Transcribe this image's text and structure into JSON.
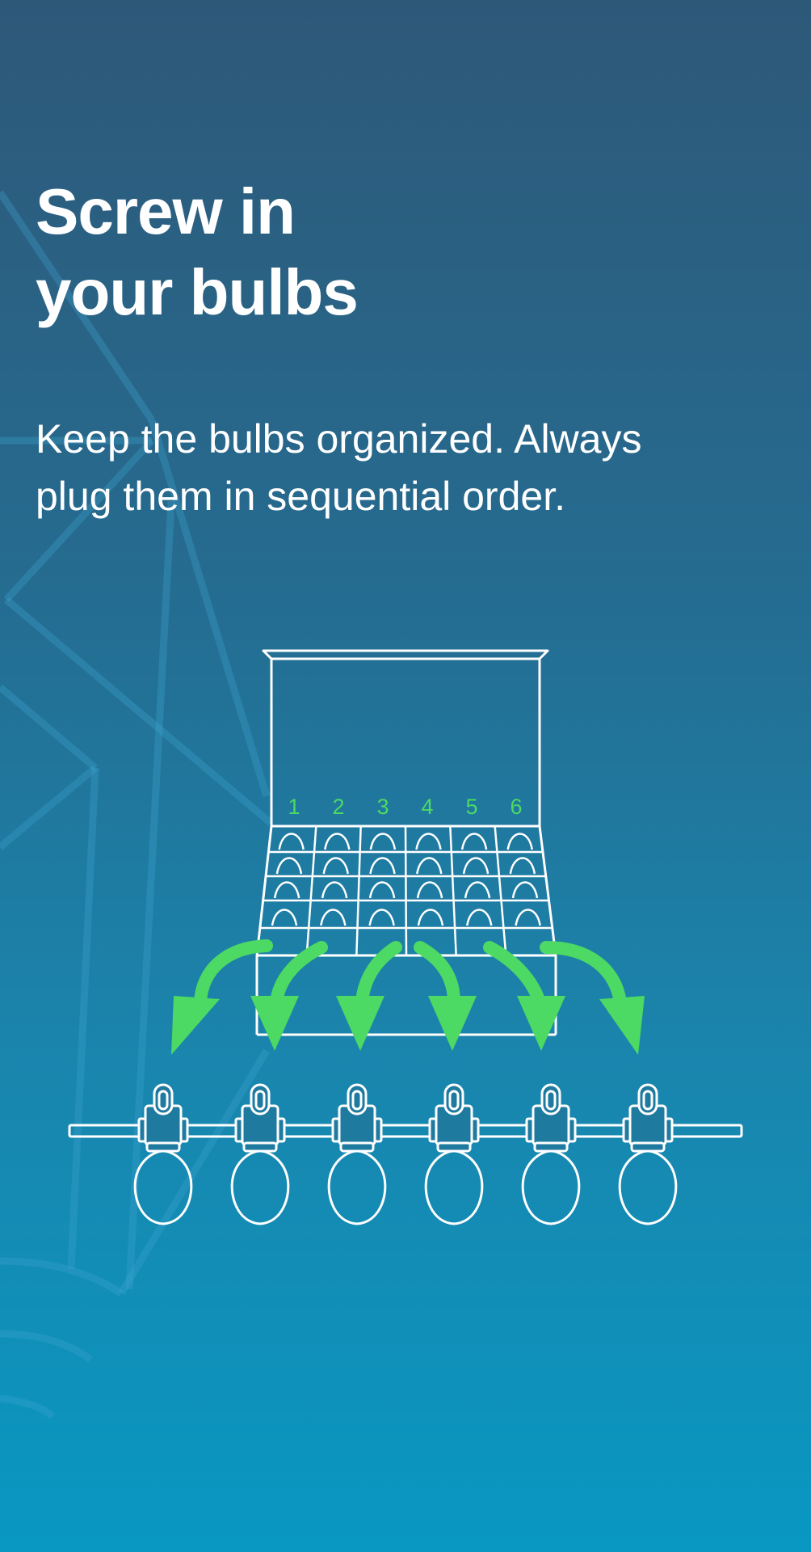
{
  "screen": {
    "title_lines": [
      "Screw in",
      "your bulbs"
    ],
    "description_lines": [
      "Keep the bulbs organized. Always",
      "plug them in sequential order."
    ]
  },
  "illustration": {
    "tray_numbers": [
      "1",
      "2",
      "3",
      "4",
      "5",
      "6"
    ],
    "bulb_count": 6,
    "colors": {
      "line": "#ffffff",
      "accent": "#4cd964",
      "bg_top": "#2e5878",
      "bg_bottom": "#0898c2"
    }
  }
}
